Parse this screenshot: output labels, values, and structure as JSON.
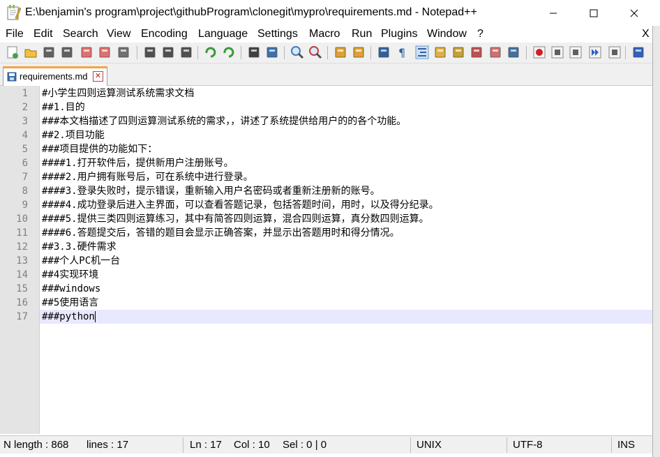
{
  "window": {
    "title": "E:\\benjamin's program\\project\\githubProgram\\clonegit\\mypro\\requirements.md - Notepad++",
    "app_icon": "notepadpp-icon",
    "controls": {
      "minimize_icon": "minimize-icon",
      "maximize_icon": "maximize-icon",
      "close_icon": "close-icon"
    }
  },
  "menu": {
    "items": [
      "File",
      "Edit",
      "Search",
      "View",
      "Encoding",
      "Language",
      "Settings",
      "Macro",
      "Run",
      "Plugins",
      "Window",
      "?"
    ],
    "close_label": "X"
  },
  "toolbar": {
    "icons": [
      "new-file-icon",
      "open-file-icon",
      "save-icon",
      "save-all-icon",
      "close-icon",
      "close-all-icon",
      "print-icon",
      "cut-icon",
      "copy-icon",
      "paste-icon",
      "undo-icon",
      "redo-icon",
      "find-icon",
      "replace-icon",
      "zoom-in-icon",
      "zoom-out-icon",
      "sync-vertical-icon",
      "sync-horizontal-icon",
      "word-wrap-icon",
      "show-all-chars-icon",
      "indent-guide-icon",
      "doc-map-icon",
      "function-list-icon",
      "folder-workspace-icon",
      "doc-list-icon",
      "monitoring-icon",
      "record-macro-icon",
      "stop-record-icon",
      "play-macro-icon",
      "run-macro-multiple-icon",
      "save-macro-icon",
      "spell-check-icon"
    ]
  },
  "tabs": [
    {
      "label": "requirements.md",
      "active": true,
      "icon": "file-saved-icon",
      "close_label": "✕"
    }
  ],
  "editor": {
    "lines": [
      {
        "num": "1",
        "text": "#小学生四则运算测试系统需求文档"
      },
      {
        "num": "2",
        "text": "##1.目的"
      },
      {
        "num": "3",
        "text": "###本文档描述了四则运算测试系统的需求，，讲述了系统提供给用户的的各个功能。"
      },
      {
        "num": "4",
        "text": "##2.项目功能"
      },
      {
        "num": "5",
        "text": "###项目提供的功能如下："
      },
      {
        "num": "6",
        "text": "####1.打开软件后，提供新用户注册账号。"
      },
      {
        "num": "7",
        "text": "####2.用户拥有账号后，可在系统中进行登录。"
      },
      {
        "num": "8",
        "text": "####3.登录失败时，提示错误，重新输入用户名密码或者重新注册新的账号。"
      },
      {
        "num": "9",
        "text": "####4.成功登录后进入主界面，可以查看答题记录，包括答题时间，用时，以及得分纪录。"
      },
      {
        "num": "10",
        "text": "####5.提供三类四则运算练习，其中有简答四则运算，混合四则运算，真分数四则运算。"
      },
      {
        "num": "11",
        "text": "####6.答题提交后，答错的题目会显示正确答案，并显示出答题用时和得分情况。"
      },
      {
        "num": "12",
        "text": "##3.3.硬件需求"
      },
      {
        "num": "13",
        "text": "###个人PC机一台"
      },
      {
        "num": "14",
        "text": "##4实现环境"
      },
      {
        "num": "15",
        "text": "###windows"
      },
      {
        "num": "16",
        "text": "##5使用语言"
      },
      {
        "num": "17",
        "text": "###python"
      }
    ],
    "current_line": 17
  },
  "status": {
    "length": "N length : 868",
    "lines": "lines : 17",
    "ln": "Ln : 17",
    "col": "Col : 10",
    "sel": "Sel : 0 | 0",
    "eol": "UNIX",
    "encoding": "UTF-8",
    "mode": "INS"
  },
  "colors": {
    "current_line_bg": "#e8e8ff",
    "gutter_bg": "#e4e4e4",
    "line_number": "#808080",
    "tab_accent": "#f4a340",
    "tab_close": "#c02020"
  }
}
